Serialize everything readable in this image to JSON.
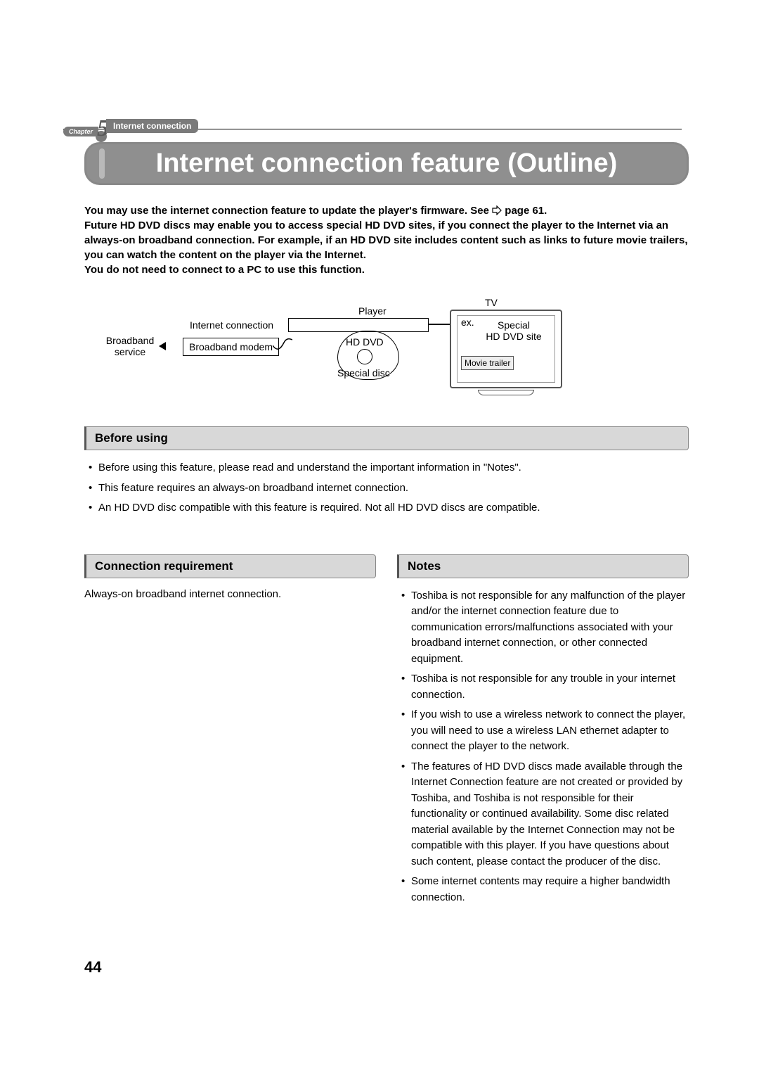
{
  "chapter": {
    "label": "Chapter",
    "number": "5",
    "title": "Internet connection"
  },
  "main_title": "Internet connection feature (Outline)",
  "intro": {
    "line1a": "You may use the internet connection feature to update the player's firmware. See ",
    "line1b": " page 61.",
    "line2": "Future HD DVD discs may enable you to access special HD DVD sites, if you connect the player to the Internet via an always-on broadband connection. For example, if an HD DVD site includes content such as links to future movie trailers, you can watch the content on the player via the Internet.",
    "line3": "You do not need to connect to a PC to use this function."
  },
  "diagram": {
    "broadband_service": "Broadband\nservice",
    "internet_connection": "Internet connection",
    "broadband_modem": "Broadband modem",
    "player": "Player",
    "hd_dvd": "HD DVD",
    "special_disc": "Special disc",
    "tv": "TV",
    "ex": "ex.",
    "special_site": "Special\nHD DVD site",
    "movie_trailer": "Movie trailer"
  },
  "before_using": {
    "header": "Before using",
    "items": [
      "Before using this feature, please read and understand the important information in \"Notes\".",
      "This feature requires an always-on broadband internet connection.",
      "An HD DVD disc compatible with this feature is required. Not all HD DVD discs are compatible."
    ]
  },
  "connection_req": {
    "header": "Connection requirement",
    "text": "Always-on broadband internet connection."
  },
  "notes": {
    "header": "Notes",
    "items": [
      "Toshiba is not responsible for any malfunction of the player and/or the internet connection feature due to communication errors/malfunctions associated with your broadband internet connection, or other connected equipment.",
      "Toshiba is not responsible for any trouble in your internet connection.",
      "If you wish to use a wireless network to connect the player, you will need to use a wireless LAN ethernet adapter to connect the player to the network.",
      "The features of HD DVD discs made available through the Internet Connection feature are not created or provided by Toshiba, and Toshiba is not responsible for their functionality or continued availability. Some disc related material available by the Internet Connection may not be compatible with this player. If you have questions about such content, please contact the producer of the disc.",
      "Some internet contents may require a higher bandwidth connection."
    ]
  },
  "page_number": "44"
}
